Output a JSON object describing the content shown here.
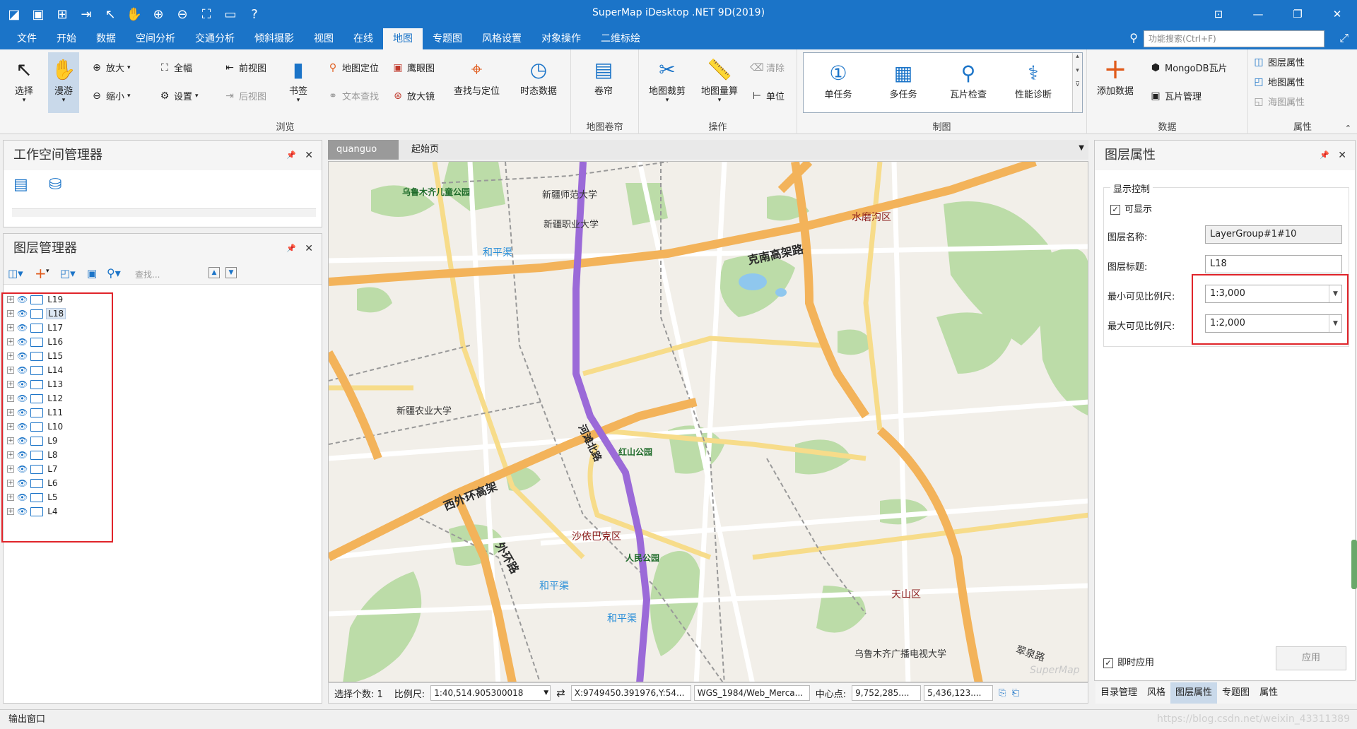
{
  "app": {
    "title": "SuperMap iDesktop .NET 9D(2019)"
  },
  "menu": {
    "tabs": [
      "文件",
      "开始",
      "数据",
      "空间分析",
      "交通分析",
      "倾斜摄影",
      "视图",
      "在线",
      "地图",
      "专题图",
      "风格设置",
      "对象操作",
      "二维标绘"
    ],
    "active": "地图",
    "search_placeholder": "功能搜索(Ctrl+F)"
  },
  "ribbon": {
    "browse": {
      "label": "浏览",
      "select": "选择",
      "pan": "漫游",
      "zoom_in": "放大",
      "zoom_out": "缩小",
      "full_extent": "全幅",
      "settings": "设置",
      "prev_view": "前视图",
      "next_view": "后视图",
      "bookmark": "书签",
      "locate": "地图定位",
      "text_search": "文本查找",
      "eagle_eye": "鹰眼图",
      "magnifier": "放大镜",
      "find_locate": "查找与定位",
      "dynamic_data": "时态数据"
    },
    "scroll": {
      "label": "地图卷帘",
      "btn": "卷帘"
    },
    "operation": {
      "label": "操作",
      "clip": "地图裁剪",
      "measure": "地图量算",
      "clear": "清除",
      "unit": "单位"
    },
    "tile": {
      "label": "制图",
      "single_task": "单任务",
      "multi_task": "多任务",
      "tile_check": "瓦片检查",
      "diagnose": "性能诊断"
    },
    "data": {
      "label": "数据",
      "add_data": "添加数据",
      "mongodb_tile": "MongoDB瓦片",
      "tile_manage": "瓦片管理"
    },
    "props": {
      "label": "属性",
      "layer_props": "图层属性",
      "map_props": "地图属性",
      "chart_props": "海图属性"
    }
  },
  "workspace_panel": {
    "title": "工作空间管理器"
  },
  "layer_panel": {
    "title": "图层管理器",
    "search_placeholder": "查找...",
    "layers": [
      "L19",
      "L18",
      "L17",
      "L16",
      "L15",
      "L14",
      "L13",
      "L12",
      "L11",
      "L10",
      "L9",
      "L8",
      "L7",
      "L6",
      "L5",
      "L4"
    ],
    "selected": "L18"
  },
  "doc_tabs": [
    {
      "label": "quanguo",
      "close": "×"
    },
    {
      "label": "起始页"
    }
  ],
  "map": {
    "poi": [
      "乌鲁木齐儿童公园",
      "新疆师范大学",
      "新疆职业大学",
      "新疆农业大学",
      "乌鲁木齐广播电视大学"
    ],
    "districts": [
      "水磨沟区",
      "沙依巴克区",
      "天山区"
    ],
    "water": [
      "和平渠",
      "和平渠",
      "和平渠"
    ],
    "parks": [
      "红山公园",
      "人民公园"
    ],
    "roads": [
      "克南高架路",
      "西外环高架",
      "外环路",
      "河滩北路",
      "翠泉路"
    ],
    "watermark": "SuperMap"
  },
  "status": {
    "selected_label": "选择个数: 1",
    "scale_label": "比例尺:",
    "scale_value": "1:40,514.905300018",
    "coords": "X:9749450.391976,Y:54...",
    "crs": "WGS_1984/Web_Merca...",
    "center_label": "中心点:",
    "center_x": "9,752,285....",
    "center_y": "5,436,123...."
  },
  "layer_props": {
    "title": "图层属性",
    "display_group": "显示控制",
    "visible_label": "可显示",
    "name_label": "图层名称:",
    "name_value": "LayerGroup#1#10",
    "caption_label": "图层标题:",
    "caption_value": "L18",
    "min_scale_label": "最小可见比例尺:",
    "min_scale_value": "1:3,000",
    "max_scale_label": "最大可见比例尺:",
    "max_scale_value": "1:2,000",
    "instant_apply": "即时应用",
    "apply": "应用"
  },
  "bottom_tabs": [
    "目录管理",
    "风格",
    "图层属性",
    "专题图",
    "属性"
  ],
  "bottom_tab_active": "图层属性",
  "output_window": "输出窗口",
  "watermark": "https://blog.csdn.net/weixin_43311389"
}
